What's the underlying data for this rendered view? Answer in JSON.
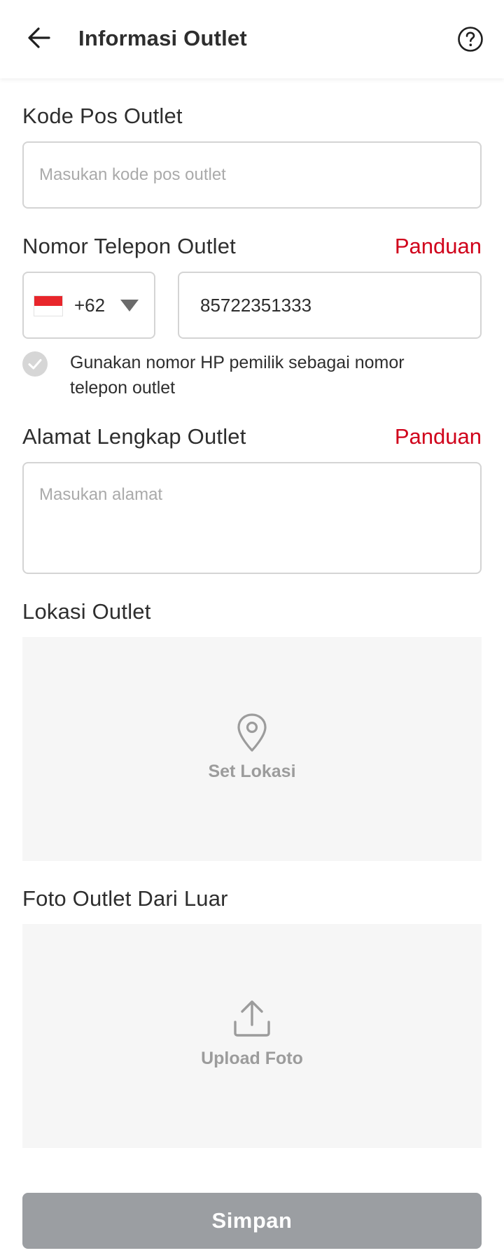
{
  "header": {
    "title": "Informasi Outlet",
    "back_icon": "arrow-left-icon",
    "help_icon": "question-circle-icon"
  },
  "postal_code": {
    "label": "Kode Pos Outlet",
    "placeholder": "Masukan kode pos outlet",
    "value": ""
  },
  "phone": {
    "label": "Nomor Telepon Outlet",
    "guide_link": "Panduan",
    "country_flag": "indonesia-flag-icon",
    "country_code": "+62",
    "value": "85722351333",
    "use_owner_number_text": "Gunakan nomor HP pemilik sebagai nomor telepon outlet",
    "use_owner_number_checked": false
  },
  "address": {
    "label": "Alamat Lengkap Outlet",
    "guide_link": "Panduan",
    "placeholder": "Masukan alamat",
    "value": ""
  },
  "location": {
    "label": "Lokasi Outlet",
    "action_label": "Set Lokasi",
    "icon": "map-pin-icon"
  },
  "photo": {
    "label": "Foto Outlet Dari Luar",
    "action_label": "Upload Foto",
    "icon": "upload-icon"
  },
  "save_button": {
    "label": "Simpan",
    "enabled": false
  },
  "colors": {
    "accent_red": "#d0021b",
    "disabled_button": "#9b9ea2",
    "placeholder_area": "#f6f6f6",
    "border": "#d4d4d4"
  }
}
